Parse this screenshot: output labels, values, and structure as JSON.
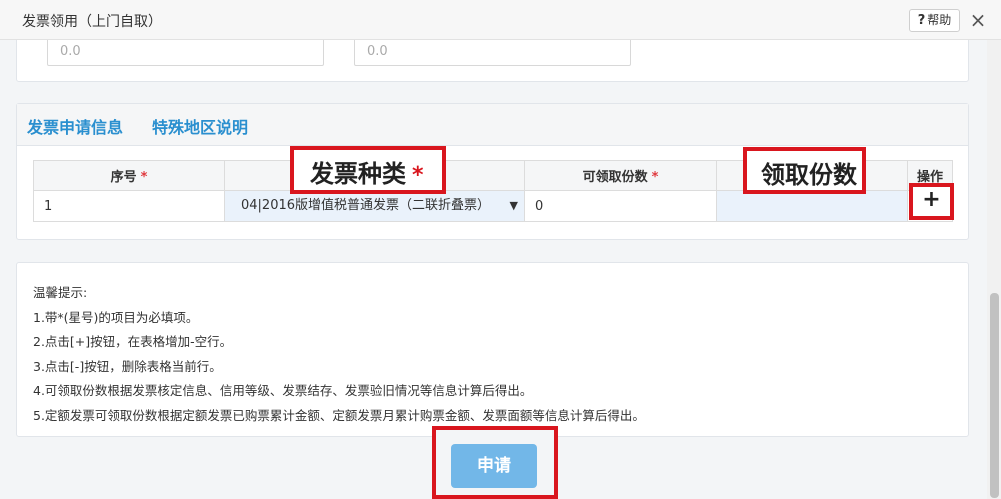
{
  "window": {
    "title": "发票领用（上门自取）",
    "help_label": "帮助",
    "help_icon": "?",
    "close_icon": "×"
  },
  "top_fields": [
    {
      "value": "0.0"
    },
    {
      "value": "0.0"
    }
  ],
  "tabs": [
    {
      "label": "发票申请信息"
    },
    {
      "label": "特殊地区说明"
    }
  ],
  "table": {
    "headers": {
      "seq": "序号",
      "type": "发票种类",
      "available": "可领取份数",
      "qty": "领取份数",
      "action": "操作"
    },
    "required_mark": "*",
    "rows": [
      {
        "seq": "1",
        "type": "04|2016版增值税普通发票（二联折叠票）",
        "available": "0",
        "qty": ""
      }
    ]
  },
  "add_row_icon": "+",
  "tips": {
    "title": "温馨提示:",
    "items": [
      "1.带*(星号)的项目为必填项。",
      "2.点击[+]按钮，在表格增加-空行。",
      "3.点击[-]按钮，删除表格当前行。",
      "4.可领取份数根据发票核定信息、信用等级、发票结存、发票验旧情况等信息计算后得出。",
      "5.定额发票可领取份数根据定额发票已购票累计金额、定额发票月累计购票金额、发票面额等信息计算后得出。"
    ]
  },
  "submit_label": "申请",
  "colors": {
    "accent": "#2a8fcf",
    "highlight": "#d9161e",
    "button": "#72b7e8"
  }
}
